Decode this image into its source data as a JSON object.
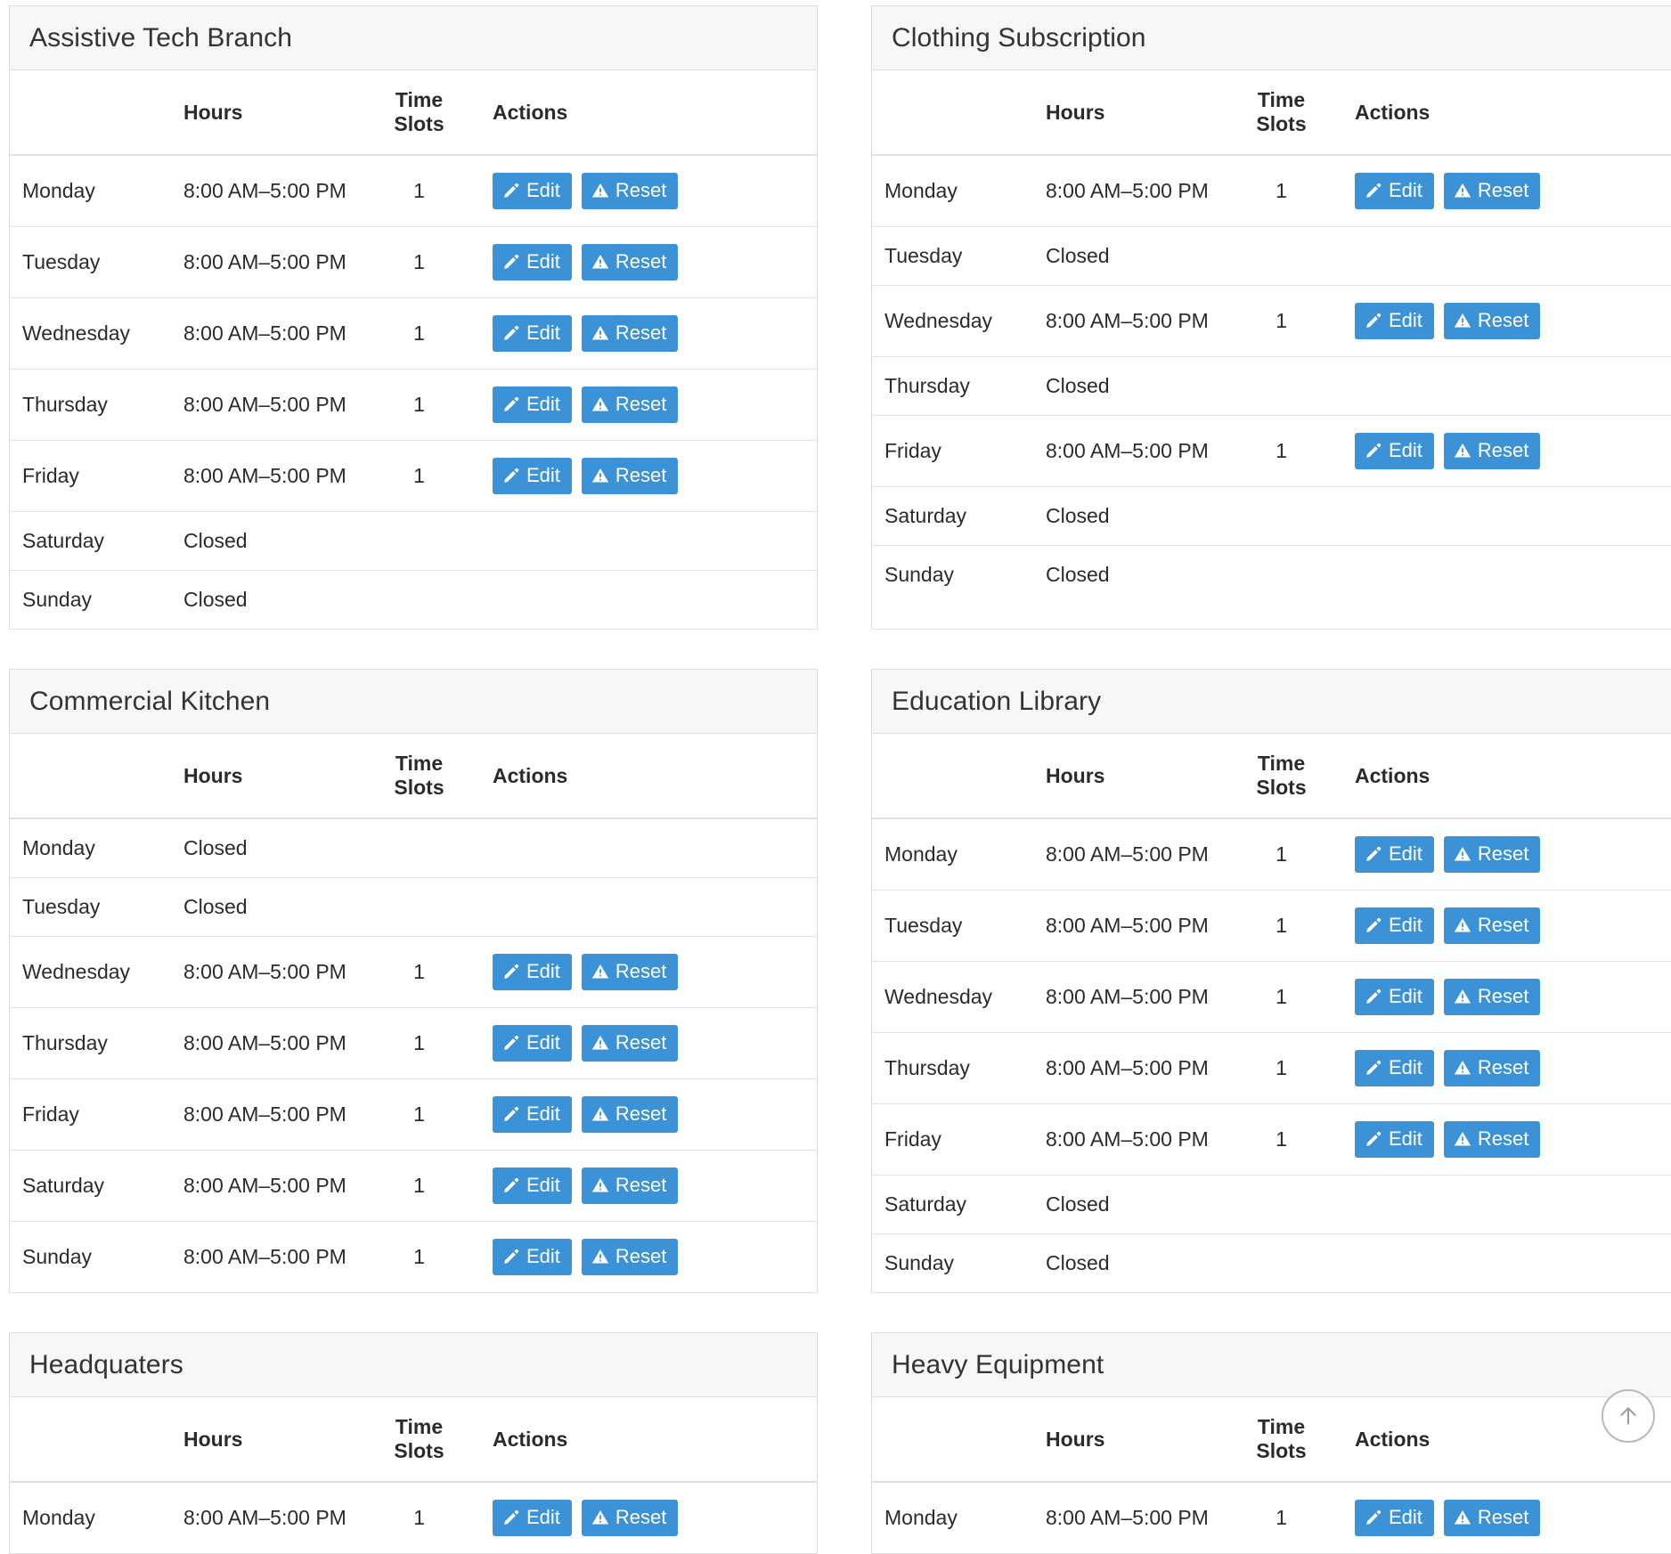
{
  "table": {
    "columns": [
      "",
      "Hours",
      "Time Slots",
      "Actions"
    ],
    "day_column_header": "",
    "hours_header": "Hours",
    "slots_header": "Time Slots",
    "actions_header": "Actions"
  },
  "labels": {
    "edit": "Edit",
    "reset": "Reset",
    "closed": "Closed",
    "standard_hours": "8:00 AM–5:00 PM",
    "one_slot": "1"
  },
  "colors": {
    "button_blue": "#3c92d6",
    "card_header_bg": "#f7f7f7",
    "card_border": "#dfdfdf",
    "row_border": "#e4e4e4",
    "text": "#2b2b2b"
  },
  "icons": {
    "edit": "pencil-icon",
    "reset": "warning-triangle-icon",
    "scroll_top": "arrow-up-icon"
  },
  "cards": [
    {
      "title": "Assistive Tech Branch",
      "rows": [
        {
          "day": "Monday",
          "hours": "8:00 AM–5:00 PM",
          "slots": "1",
          "actions": true
        },
        {
          "day": "Tuesday",
          "hours": "8:00 AM–5:00 PM",
          "slots": "1",
          "actions": true
        },
        {
          "day": "Wednesday",
          "hours": "8:00 AM–5:00 PM",
          "slots": "1",
          "actions": true
        },
        {
          "day": "Thursday",
          "hours": "8:00 AM–5:00 PM",
          "slots": "1",
          "actions": true
        },
        {
          "day": "Friday",
          "hours": "8:00 AM–5:00 PM",
          "slots": "1",
          "actions": true
        },
        {
          "day": "Saturday",
          "hours": "Closed",
          "slots": "",
          "actions": false
        },
        {
          "day": "Sunday",
          "hours": "Closed",
          "slots": "",
          "actions": false
        }
      ]
    },
    {
      "title": "Clothing Subscription",
      "rows": [
        {
          "day": "Monday",
          "hours": "8:00 AM–5:00 PM",
          "slots": "1",
          "actions": true
        },
        {
          "day": "Tuesday",
          "hours": "Closed",
          "slots": "",
          "actions": false
        },
        {
          "day": "Wednesday",
          "hours": "8:00 AM–5:00 PM",
          "slots": "1",
          "actions": true
        },
        {
          "day": "Thursday",
          "hours": "Closed",
          "slots": "",
          "actions": false
        },
        {
          "day": "Friday",
          "hours": "8:00 AM–5:00 PM",
          "slots": "1",
          "actions": true
        },
        {
          "day": "Saturday",
          "hours": "Closed",
          "slots": "",
          "actions": false
        },
        {
          "day": "Sunday",
          "hours": "Closed",
          "slots": "",
          "actions": false
        }
      ]
    },
    {
      "title": "Commercial Kitchen",
      "rows": [
        {
          "day": "Monday",
          "hours": "Closed",
          "slots": "",
          "actions": false
        },
        {
          "day": "Tuesday",
          "hours": "Closed",
          "slots": "",
          "actions": false
        },
        {
          "day": "Wednesday",
          "hours": "8:00 AM–5:00 PM",
          "slots": "1",
          "actions": true
        },
        {
          "day": "Thursday",
          "hours": "8:00 AM–5:00 PM",
          "slots": "1",
          "actions": true
        },
        {
          "day": "Friday",
          "hours": "8:00 AM–5:00 PM",
          "slots": "1",
          "actions": true
        },
        {
          "day": "Saturday",
          "hours": "8:00 AM–5:00 PM",
          "slots": "1",
          "actions": true
        },
        {
          "day": "Sunday",
          "hours": "8:00 AM–5:00 PM",
          "slots": "1",
          "actions": true
        }
      ]
    },
    {
      "title": "Education Library",
      "rows": [
        {
          "day": "Monday",
          "hours": "8:00 AM–5:00 PM",
          "slots": "1",
          "actions": true
        },
        {
          "day": "Tuesday",
          "hours": "8:00 AM–5:00 PM",
          "slots": "1",
          "actions": true
        },
        {
          "day": "Wednesday",
          "hours": "8:00 AM–5:00 PM",
          "slots": "1",
          "actions": true
        },
        {
          "day": "Thursday",
          "hours": "8:00 AM–5:00 PM",
          "slots": "1",
          "actions": true
        },
        {
          "day": "Friday",
          "hours": "8:00 AM–5:00 PM",
          "slots": "1",
          "actions": true
        },
        {
          "day": "Saturday",
          "hours": "Closed",
          "slots": "",
          "actions": false
        },
        {
          "day": "Sunday",
          "hours": "Closed",
          "slots": "",
          "actions": false
        }
      ]
    },
    {
      "title": "Headquaters",
      "rows": [
        {
          "day": "Monday",
          "hours": "8:00 AM–5:00 PM",
          "slots": "1",
          "actions": true
        }
      ]
    },
    {
      "title": "Heavy Equipment",
      "rows": [
        {
          "day": "Monday",
          "hours": "8:00 AM–5:00 PM",
          "slots": "1",
          "actions": true
        }
      ]
    }
  ]
}
